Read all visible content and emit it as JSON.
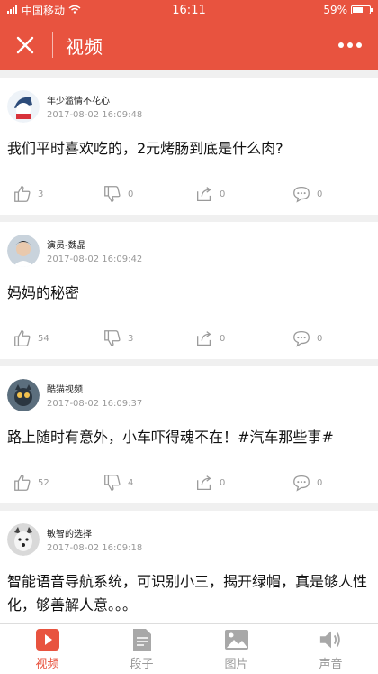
{
  "status": {
    "carrier": "中国移动",
    "time": "16:11",
    "battery": "59%",
    "battery_level": 0.59
  },
  "appbar": {
    "title": "视频"
  },
  "posts": [
    {
      "author": "年少滥情不花心",
      "time": "2017-08-02 16:09:48",
      "text": "我们平时喜欢吃的，2元烤肠到底是什么肉?",
      "likes": "3",
      "dislikes": "0",
      "shares": "0",
      "comments": "0"
    },
    {
      "author": "演员-魏晶",
      "time": "2017-08-02 16:09:42",
      "text": "妈妈的秘密",
      "likes": "54",
      "dislikes": "3",
      "shares": "0",
      "comments": "0"
    },
    {
      "author": "酷猫视频",
      "time": "2017-08-02 16:09:37",
      "text": "路上随时有意外，小车吓得魂不在！#汽车那些事#",
      "likes": "52",
      "dislikes": "4",
      "shares": "0",
      "comments": "0"
    },
    {
      "author": "敏智的选择",
      "time": "2017-08-02 16:09:18",
      "text": "智能语音导航系统，可识别小三，揭开绿帽，真是够人性化，够善解人意。。。",
      "likes": "",
      "dislikes": "",
      "shares": "",
      "comments": ""
    }
  ],
  "tabs": [
    {
      "label": "视频",
      "icon": "video-icon"
    },
    {
      "label": "段子",
      "icon": "document-icon"
    },
    {
      "label": "图片",
      "icon": "image-icon"
    },
    {
      "label": "声音",
      "icon": "speaker-icon"
    }
  ],
  "colors": {
    "accent": "#e8533f",
    "inactive": "#9a9a9a"
  }
}
